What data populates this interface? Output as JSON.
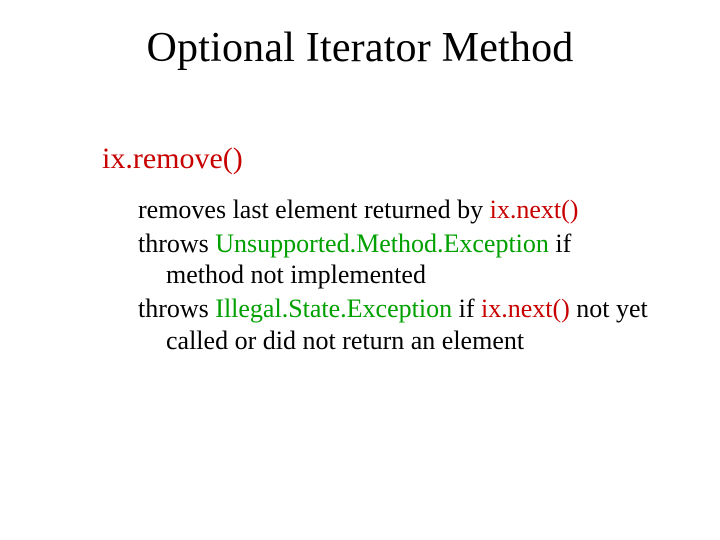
{
  "title": "Optional Iterator Method",
  "method": "ix.remove()",
  "p1_lead": "removes last element returned by ",
  "p1_call": "ix.next()",
  "p2_lead": "throws ",
  "p2_exc": "Unsupported.Method.Exception",
  "p2_tail": " if method not implemented",
  "p3_lead": "throws ",
  "p3_exc": "Illegal.State.Exception",
  "p3_mid": " if ",
  "p3_call": "ix.next()",
  "p3_tail": " not yet called or did not return an element"
}
